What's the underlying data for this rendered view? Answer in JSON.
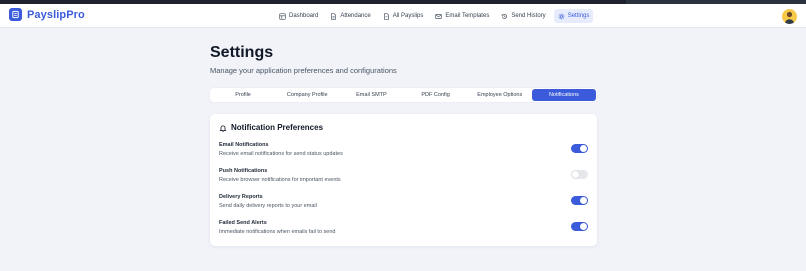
{
  "app": {
    "name": "PayslipPro",
    "brand_color": "#3b5bdb"
  },
  "nav": {
    "items": [
      {
        "label": "Dashboard",
        "icon": "grid-icon",
        "active": false
      },
      {
        "label": "Attendance",
        "icon": "document-icon",
        "active": false
      },
      {
        "label": "All Payslips",
        "icon": "file-icon",
        "active": false
      },
      {
        "label": "Email Templates",
        "icon": "mail-icon",
        "active": false
      },
      {
        "label": "Send History",
        "icon": "history-icon",
        "active": false
      },
      {
        "label": "Settings",
        "icon": "gear-icon",
        "active": true
      }
    ]
  },
  "header": {
    "title": "Settings",
    "subtitle": "Manage your application preferences and configurations"
  },
  "tabs": [
    {
      "label": "Profile",
      "active": false
    },
    {
      "label": "Company Profile",
      "active": false
    },
    {
      "label": "Email SMTP",
      "active": false
    },
    {
      "label": "PDF Config",
      "active": false
    },
    {
      "label": "Employee Options",
      "active": false
    },
    {
      "label": "Notifications",
      "active": true
    }
  ],
  "notifications": {
    "title": "Notification Preferences",
    "icon": "bell-icon",
    "items": [
      {
        "label": "Email Notifications",
        "description": "Receive email notifications for send status updates",
        "enabled": true
      },
      {
        "label": "Push Notifications",
        "description": "Receive browser notifications for important events",
        "enabled": false
      },
      {
        "label": "Delivery Reports",
        "description": "Send daily delivery reports to your email",
        "enabled": true
      },
      {
        "label": "Failed Send Alerts",
        "description": "Immediate notifications when emails fail to send",
        "enabled": true
      }
    ]
  }
}
